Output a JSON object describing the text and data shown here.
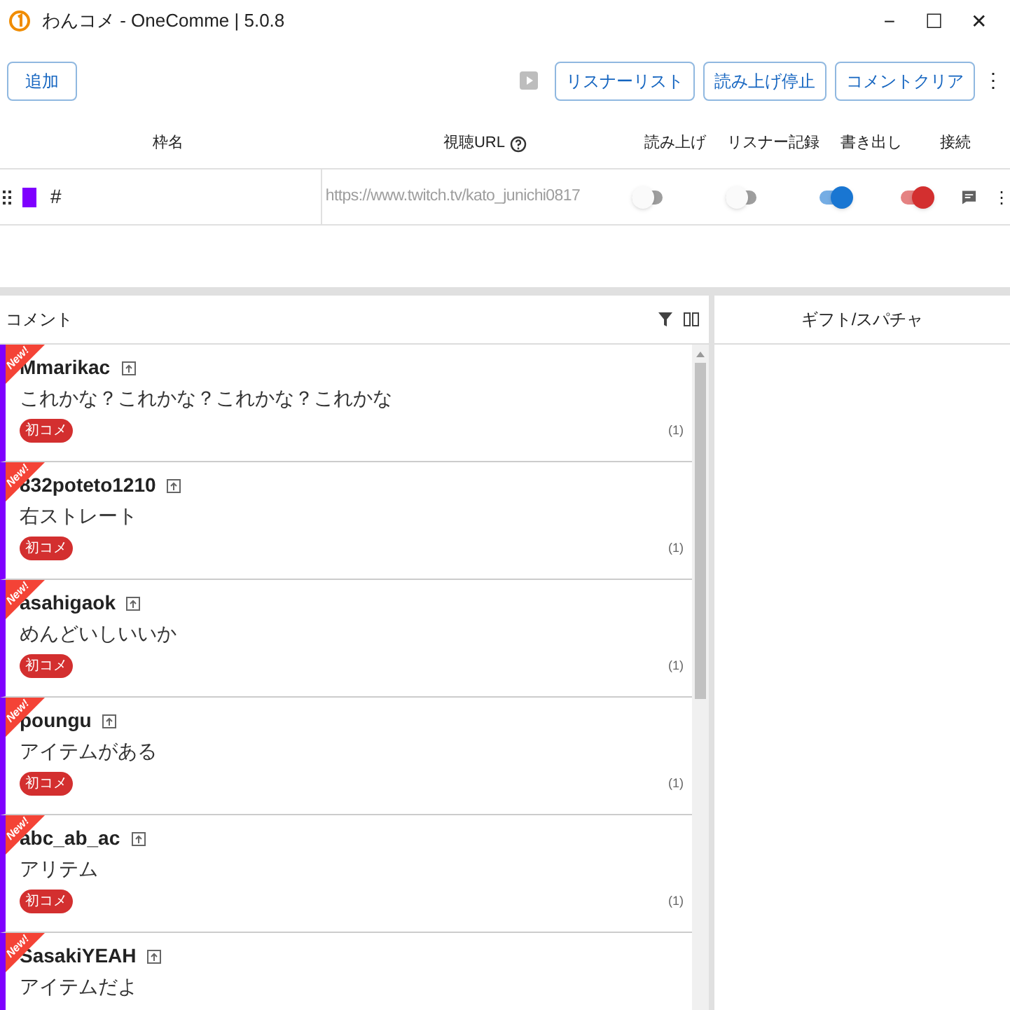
{
  "window": {
    "title": "わんコメ - OneComme | 5.0.8",
    "controls": [
      "−",
      "☐",
      "✕"
    ]
  },
  "toolbar": {
    "add_button": "追加",
    "buttons": [
      "リスナーリスト",
      "読み上げ停止",
      "コメントクリア"
    ],
    "more": "⋮"
  },
  "table": {
    "columns": [
      "枠名",
      "視聴URL",
      "読み上げ",
      "リスナー記録",
      "書き出し",
      "接続"
    ],
    "rows": [
      {
        "color": "#7f00ff",
        "name": "#",
        "url": "https://www.twitch.tv/kato_junichi0817",
        "toggles": [
          {
            "on": false,
            "color": "#9e9e9e"
          },
          {
            "on": false,
            "color": "#9e9e9e"
          },
          {
            "on": true,
            "color": "#1976d2"
          },
          {
            "on": true,
            "color": "#d32f2f"
          }
        ]
      }
    ]
  },
  "comments_panel": {
    "title": "コメント",
    "items": [
      {
        "new_label": "New!",
        "color": "#7f00ff",
        "user": "Mmarikac",
        "text": "これかな？これかな？これかな？これかな",
        "badge": "初コメ",
        "count": "(1)"
      },
      {
        "new_label": "New!",
        "color": "#7f00ff",
        "user": "832poteto1210",
        "text": "右ストレート",
        "badge": "初コメ",
        "count": "(1)"
      },
      {
        "new_label": "New!",
        "color": "#7f00ff",
        "user": "asahigaok",
        "text": "めんどいしいいか",
        "badge": "初コメ",
        "count": "(1)"
      },
      {
        "new_label": "New!",
        "color": "#7f00ff",
        "user": "poungu",
        "text": "アイテムがある",
        "badge": "初コメ",
        "count": "(1)"
      },
      {
        "new_label": "New!",
        "color": "#7f00ff",
        "user": "abc_ab_ac",
        "text": "アリテム",
        "badge": "初コメ",
        "count": "(1)"
      },
      {
        "new_label": "New!",
        "color": "#7f00ff",
        "user": "SasakiYEAH",
        "text": "アイテムだよ"
      }
    ]
  },
  "gift_panel": {
    "title": "ギフト/スパチャ"
  }
}
